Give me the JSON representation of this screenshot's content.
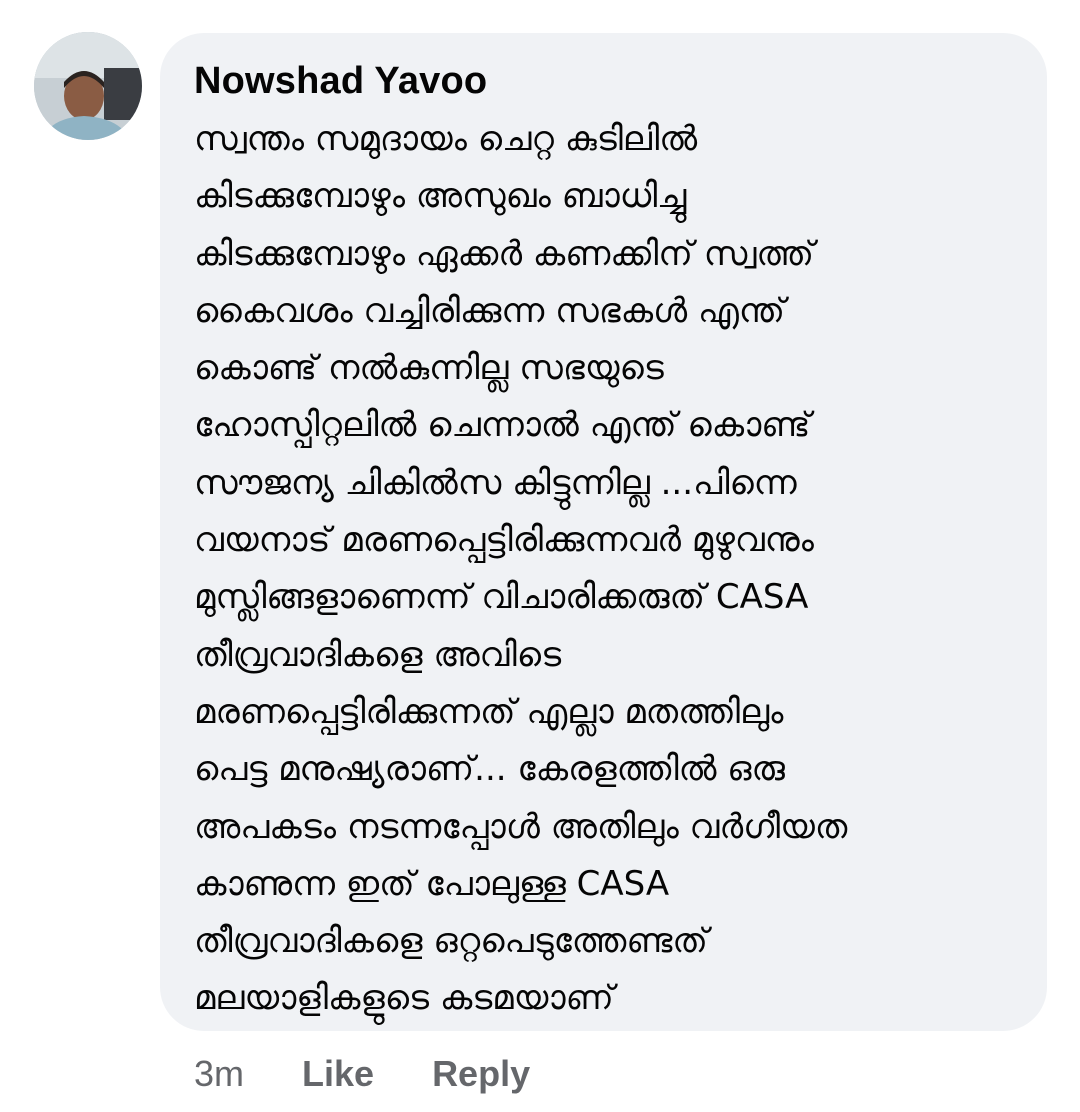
{
  "comment": {
    "author": "Nowshad Yavoo",
    "avatar_icon": "user-avatar-photo",
    "text_lines": [
      "സ്വന്തം സമുദായം ചെറ്റ കുടിലിൽ",
      "കിടക്കുമ്പോഴും  അസുഖം ബാധിച്ചു",
      "കിടക്കുമ്പോഴും  ഏക്കർ കണക്കിന് സ്വത്ത്",
      "കൈവശം വച്ചിരിക്കുന്ന സഭകൾ എന്ത്",
      "കൊണ്ട് നൽകുന്നില്ല സഭയുടെ",
      "ഹോസ്പിറ്റലിൽ ചെന്നാൽ എന്ത് കൊണ്ട്",
      "സൗജന്യ ചികിൽസ കിട്ടുന്നില്ല ...പിന്നെ",
      "വയനാട് മരണപ്പെട്ടിരിക്കുന്നവർ മുഴുവനും",
      "മുസ്ലിങ്ങളാണെന്ന്  വിചാരിക്കരുത്  CASA",
      "തീവ്രവാദികളെ  അവിടെ",
      "മരണപ്പെട്ടിരിക്കുന്നത് എല്ലാ മതത്തിലും",
      "പെട്ട മനുഷ്യരാണ്...  കേരളത്തിൽ ഒരു",
      "അപകടം നടന്നപ്പോൾ അതിലും വർഗീയത",
      "കാണുന്ന  ഇത് പോലുള്ള CASA",
      "തീവ്രവാദികളെ ഒറ്റപെടുത്തേണ്ടത്",
      "മലയാളികളുടെ  കടമയാണ്"
    ]
  },
  "actions": {
    "timestamp": "3m",
    "like_label": "Like",
    "reply_label": "Reply"
  },
  "colors": {
    "bubble_background": "#f0f2f5",
    "text": "#050505",
    "secondary_text": "#65676b"
  }
}
